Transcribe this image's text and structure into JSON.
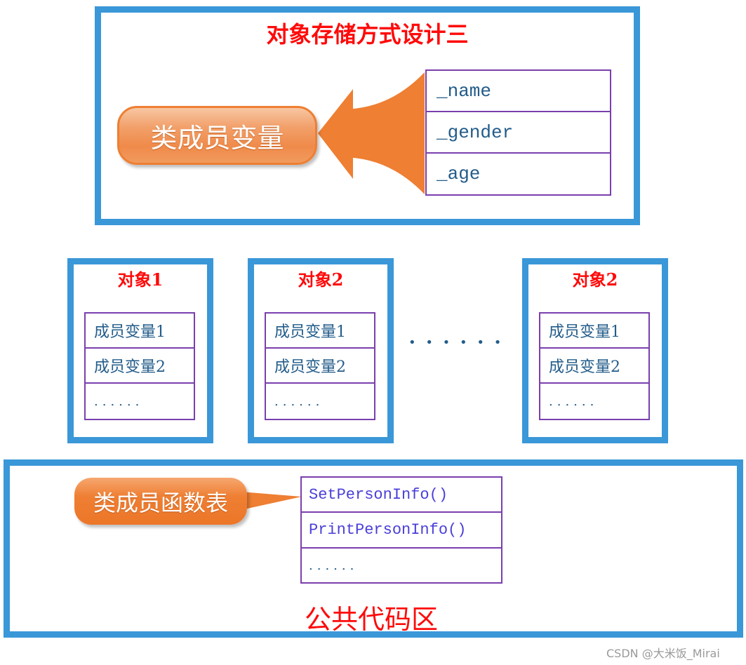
{
  "top_section": {
    "title": "对象存储方式设计三",
    "bubble_label": "类成员变量",
    "members": [
      "_name",
      "_gender",
      "_age"
    ],
    "arrow_color": "#ee7f33"
  },
  "objects": [
    {
      "title": "对象1",
      "rows": [
        "成员变量1",
        "成员变量2",
        "......"
      ]
    },
    {
      "title": "对象2",
      "rows": [
        "成员变量1",
        "成员变量2",
        "......"
      ]
    },
    {
      "title": "对象2",
      "rows": [
        "成员变量1",
        "成员变量2",
        "......"
      ]
    }
  ],
  "ellipsis": "• • • • • •",
  "bottom_section": {
    "bubble_label": "类成员函数表",
    "functions": [
      "SetPersonInfo()",
      "PrintPersonInfo()",
      "......"
    ],
    "footer_title": "公共代码区"
  },
  "watermark": "CSDN @大米饭_Mirai",
  "colors": {
    "box_border": "#3a97d8",
    "table_border": "#7a3fae",
    "title_red": "#ff0a0a",
    "member_text": "#235c8a",
    "function_text": "#4a3fd8",
    "bubble_orange": "#ee7f33"
  }
}
